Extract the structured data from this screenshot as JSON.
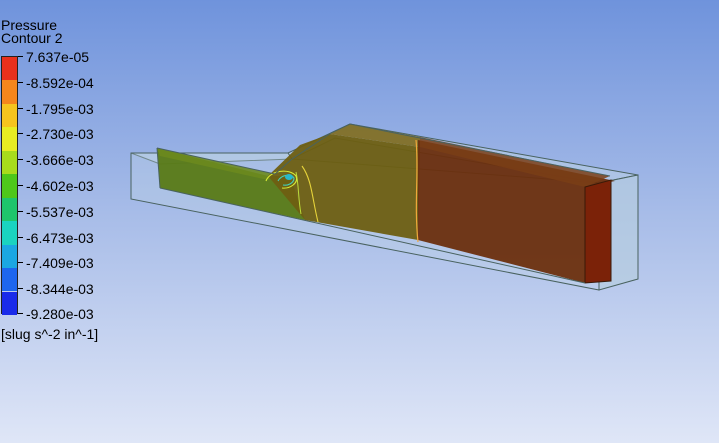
{
  "legend": {
    "title": "Pressure",
    "subtitle": "Contour 2",
    "units": "[slug s^-2 in^-1]",
    "labels": [
      "7.637e-05",
      "-8.592e-04",
      "-1.795e-03",
      "-2.730e-03",
      "-3.666e-03",
      "-4.602e-03",
      "-5.537e-03",
      "-6.473e-03",
      "-7.409e-03",
      "-8.344e-03",
      "-9.280e-03"
    ],
    "colors": [
      "#e8301c",
      "#f5861c",
      "#f6c41e",
      "#e7ec22",
      "#a8dc1c",
      "#4ec81a",
      "#1ec56c",
      "#1ad3c0",
      "#1ba7e2",
      "#1d66ee",
      "#1a2bea"
    ]
  },
  "colors": {
    "background_top": "#6f93dc",
    "background_bottom": "#dfe6f7",
    "box_fill": "#b9cfe3",
    "box_edge": "#49625f",
    "high_pressure": "#6b2f0e",
    "mid_pressure": "#6e5f12",
    "low_pressure": "#587a16",
    "outlet_face": "#7b2208"
  }
}
